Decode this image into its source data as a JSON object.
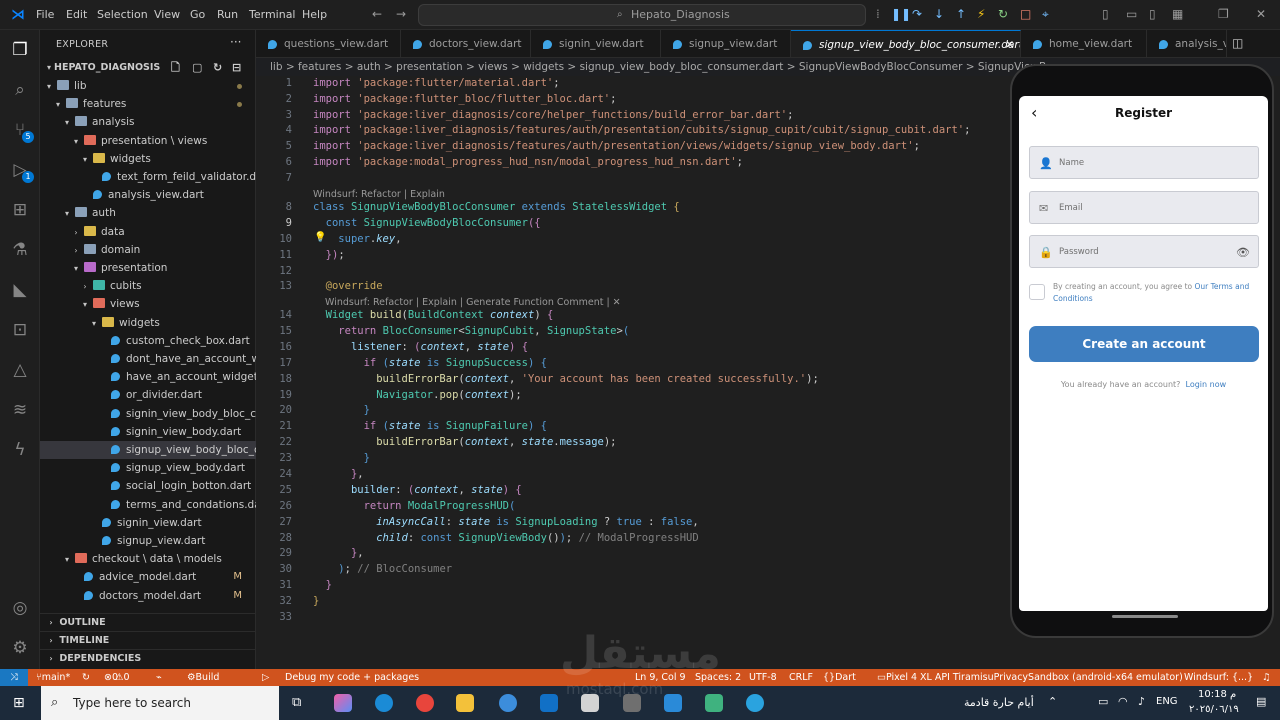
{
  "menu": [
    "File",
    "Edit",
    "Selection",
    "View",
    "Go",
    "Run",
    "Terminal",
    "Help"
  ],
  "search_placeholder": "Hepato_Diagnosis",
  "sidebar": {
    "title": "EXPLORER",
    "project": "HEPATO_DIAGNOSIS",
    "tree": [
      {
        "label": "lib",
        "kind": "folder-open",
        "depth": 1,
        "mod": "dot"
      },
      {
        "label": "features",
        "kind": "folder-open",
        "depth": 2,
        "mod": "dot"
      },
      {
        "label": "analysis",
        "kind": "folder-open",
        "depth": 3
      },
      {
        "label": "presentation \\ views",
        "kind": "folder-open-red",
        "depth": 4
      },
      {
        "label": "widgets",
        "kind": "folder-open-yellow",
        "depth": 5
      },
      {
        "label": "text_form_feild_validator.d...",
        "kind": "dart",
        "depth": 6
      },
      {
        "label": "analysis_view.dart",
        "kind": "dart",
        "depth": 5
      },
      {
        "label": "auth",
        "kind": "folder-open",
        "depth": 3
      },
      {
        "label": "data",
        "kind": "folder-yellow",
        "depth": 4
      },
      {
        "label": "domain",
        "kind": "folder",
        "depth": 4
      },
      {
        "label": "presentation",
        "kind": "folder-open-purple",
        "depth": 4
      },
      {
        "label": "cubits",
        "kind": "folder-teal",
        "depth": 5
      },
      {
        "label": "views",
        "kind": "folder-open-red",
        "depth": 5
      },
      {
        "label": "widgets",
        "kind": "folder-open-yellow",
        "depth": 6
      },
      {
        "label": "custom_check_box.dart",
        "kind": "dart",
        "depth": 7
      },
      {
        "label": "dont_have_an_account_w...",
        "kind": "dart",
        "depth": 7
      },
      {
        "label": "have_an_account_widget....",
        "kind": "dart",
        "depth": 7
      },
      {
        "label": "or_divider.dart",
        "kind": "dart",
        "depth": 7
      },
      {
        "label": "signin_view_body_bloc_c...",
        "kind": "dart",
        "depth": 7
      },
      {
        "label": "signin_view_body.dart",
        "kind": "dart",
        "depth": 7
      },
      {
        "label": "signup_view_body_bloc_c...",
        "kind": "dart",
        "depth": 7,
        "selected": true
      },
      {
        "label": "signup_view_body.dart",
        "kind": "dart",
        "depth": 7
      },
      {
        "label": "social_login_botton.dart",
        "kind": "dart",
        "depth": 7
      },
      {
        "label": "terms_and_condations.dart",
        "kind": "dart",
        "depth": 7
      },
      {
        "label": "signin_view.dart",
        "kind": "dart",
        "depth": 6
      },
      {
        "label": "signup_view.dart",
        "kind": "dart",
        "depth": 6
      },
      {
        "label": "checkout \\ data \\ models",
        "kind": "folder-open-red",
        "depth": 3
      },
      {
        "label": "advice_model.dart",
        "kind": "dart",
        "depth": 4,
        "mod": "M"
      },
      {
        "label": "doctors_model.dart",
        "kind": "dart",
        "depth": 4,
        "mod": "M"
      }
    ],
    "sections": [
      "OUTLINE",
      "TIMELINE",
      "DEPENDENCIES"
    ]
  },
  "tabs": [
    "questions_view.dart",
    "doctors_view.dart",
    "signin_view.dart",
    "signup_view.dart",
    "signup_view_body_bloc_consumer.dart",
    "home_view.dart",
    "analysis_vie"
  ],
  "breadcrumb": "lib > features > auth > presentation > views > widgets > signup_view_body_bloc_consumer.dart > SignupViewBodyBlocConsumer > SignupViewBo",
  "code": {
    "line_numbers": [
      "1",
      "2",
      "3",
      "4",
      "5",
      "6",
      "7",
      "8",
      "9",
      "10",
      "11",
      "12",
      "13",
      "14",
      "15",
      "16",
      "17",
      "18",
      "19",
      "20",
      "21",
      "22",
      "23",
      "24",
      "25",
      "26",
      "27",
      "28",
      "29",
      "30",
      "31",
      "32",
      "33"
    ],
    "lens1": "Windsurf: Refactor | Explain",
    "lens2": "Windsurf: Refactor | Explain | Generate Function Comment | ✕"
  },
  "phone": {
    "title": "Register",
    "name_placeholder": "Name",
    "email_placeholder": "Email",
    "password_placeholder": "Password",
    "terms_prefix": "By creating an account, you agree to",
    "terms_link": "Our Terms and",
    "terms_link2": "Conditions",
    "create_button": "Create an account",
    "login_prompt": "You already have an account?",
    "login_link": "Login now"
  },
  "status": {
    "branch": "main*",
    "errors": "0",
    "warnings": "0",
    "build": "Build",
    "debug": "Debug my code + packages",
    "position": "Ln 9, Col 9",
    "spaces": "Spaces: 2",
    "encoding": "UTF-8",
    "eol": "CRLF",
    "language": "Dart",
    "device": "Pixel 4 XL API TiramisuPrivacySandbox (android-x64 emulator)",
    "windsurf": "Windsurf: {...}"
  },
  "taskbar": {
    "search": "Type here to search",
    "weather": "أيام حارة قادمة",
    "lang": "ENG",
    "time": "10:18 م",
    "date": "٢٠٢٥/٠٦/١٩"
  },
  "watermark": "مستقل",
  "watermark_url": "mostaql.com",
  "colors": {
    "accent": "#0078d4",
    "status_bar": "#d0531e",
    "button": "#3e7ec0"
  }
}
